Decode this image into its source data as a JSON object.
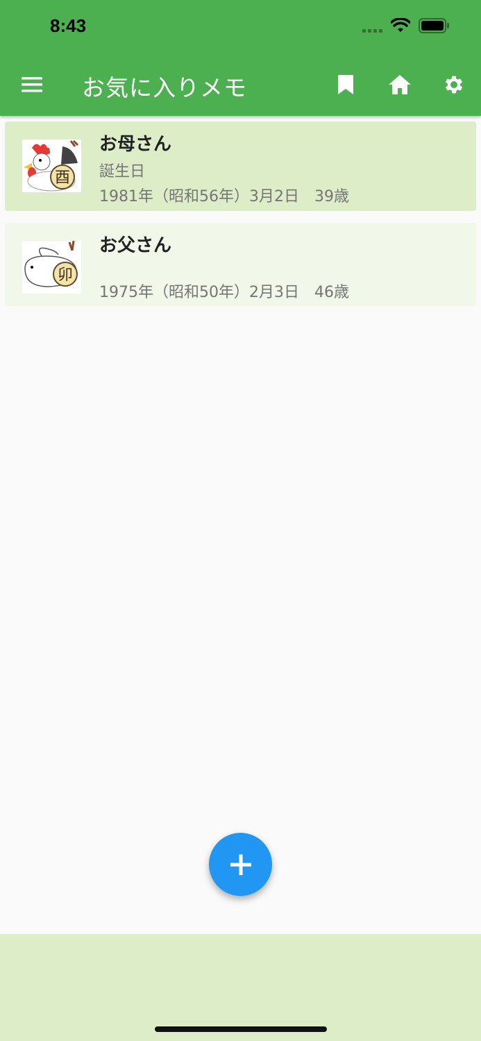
{
  "status": {
    "time": "8:43"
  },
  "appbar": {
    "title": "お気に入りメモ",
    "menu_icon": "menu-icon",
    "bookmark_icon": "bookmark-icon",
    "home_icon": "home-icon",
    "settings_icon": "gear-icon",
    "color": "#4caf50"
  },
  "items": [
    {
      "name": "お母さん",
      "subtitle": "誕生日",
      "date": "1981年（昭和56年）3月2日　39歳",
      "zodiac": "酉",
      "selected": true
    },
    {
      "name": "お父さん",
      "subtitle": "",
      "date": "1975年（昭和50年）2月3日　46歳",
      "zodiac": "卯",
      "selected": false
    }
  ],
  "fab": {
    "icon": "plus-icon",
    "color": "#2196f3"
  }
}
